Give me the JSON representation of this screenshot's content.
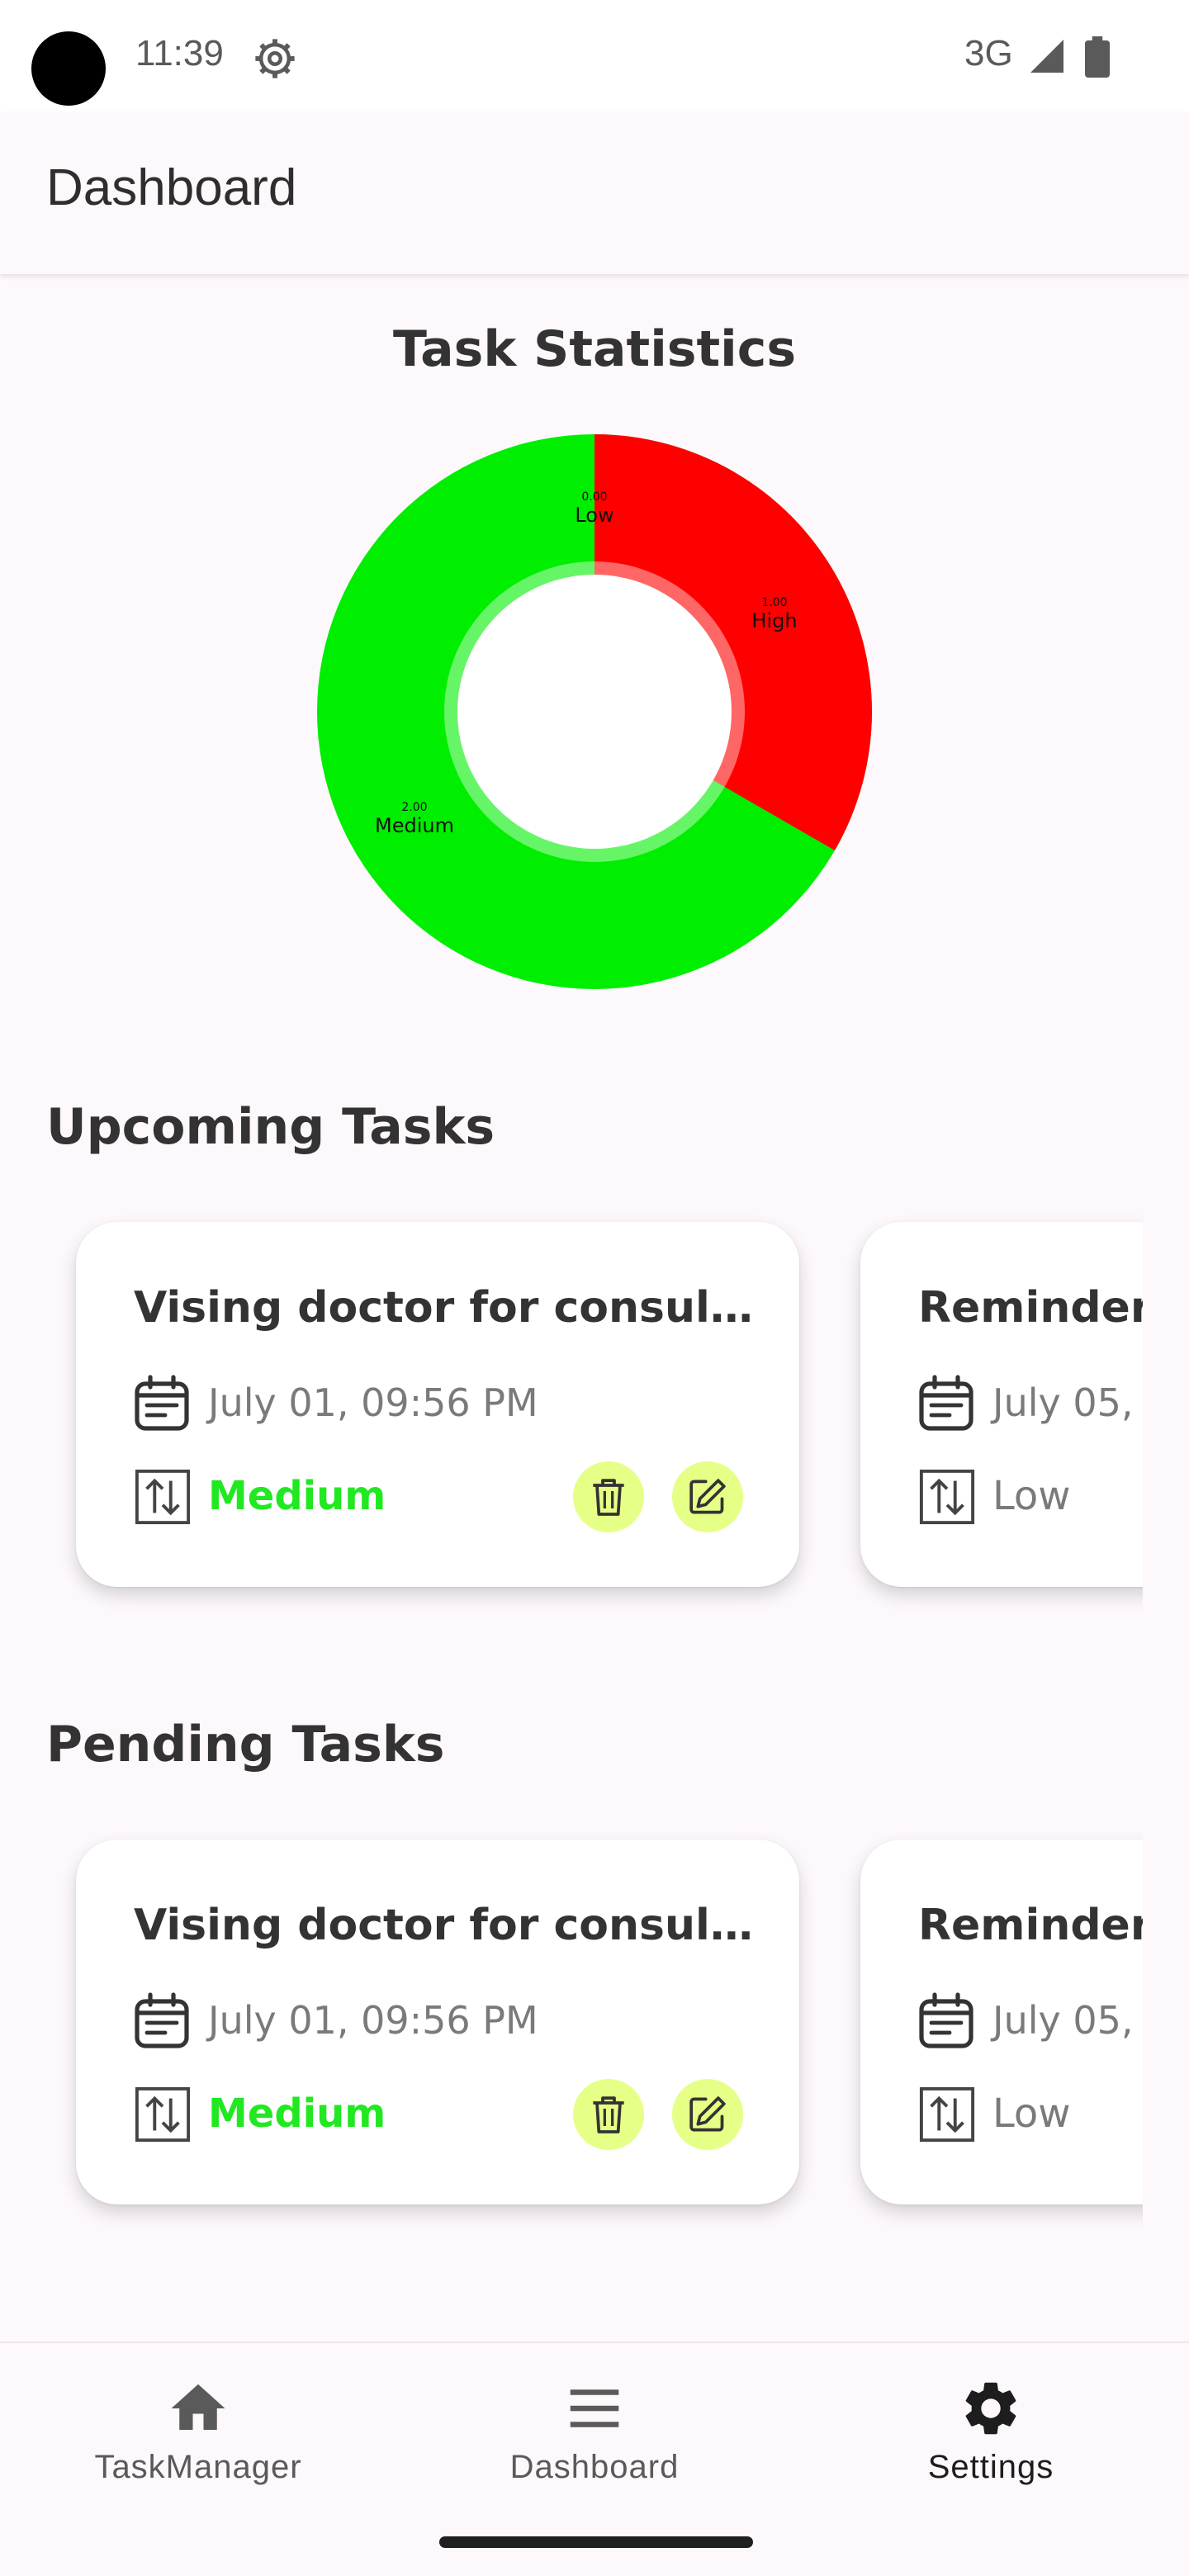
{
  "status_bar": {
    "time": "11:39",
    "network": "3G"
  },
  "app_bar": {
    "title": "Dashboard"
  },
  "statistics": {
    "title": "Task Statistics",
    "chart_data": {
      "type": "pie",
      "categories": [
        "Low",
        "High",
        "Medium"
      ],
      "values": [
        0.0,
        1.0,
        2.0
      ],
      "value_labels": [
        "0.00",
        "1.00",
        "2.00"
      ],
      "colors": [
        "#ff0000",
        "#ff0000",
        "#00ee00"
      ]
    }
  },
  "upcoming": {
    "title": "Upcoming Tasks",
    "cards": [
      {
        "title": "Vising doctor for consultation",
        "date": "July 01, 09:56 PM",
        "priority": "Medium",
        "priority_color": "#22e822"
      },
      {
        "title": "Reminder",
        "date": "July 05,",
        "priority": "Low",
        "priority_color": "#7a7a7a"
      }
    ]
  },
  "pending": {
    "title": "Pending Tasks",
    "cards": [
      {
        "title": "Vising doctor for consultation",
        "date": "July 01, 09:56 PM",
        "priority": "Medium",
        "priority_color": "#22e822"
      },
      {
        "title": "Reminder",
        "date": "July 05,",
        "priority": "Low",
        "priority_color": "#7a7a7a"
      }
    ]
  },
  "bottom_nav": {
    "items": [
      {
        "label": "TaskManager",
        "icon": "home-icon"
      },
      {
        "label": "Dashboard",
        "icon": "menu-icon"
      },
      {
        "label": "Settings",
        "icon": "settings-icon",
        "active": true
      }
    ]
  }
}
